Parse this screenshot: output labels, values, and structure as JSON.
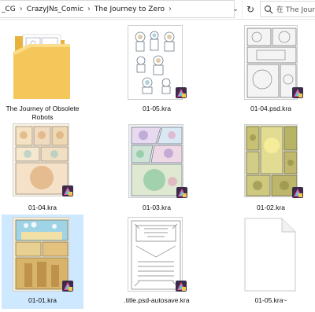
{
  "address_bar": {
    "crumbs": [
      "_CG",
      "CrazyJNs_Comic",
      "The Journey to Zero"
    ],
    "search_placeholder": "在 The Journey"
  },
  "files": [
    {
      "name": "The Journey of Obsolete Robots",
      "type": "folder"
    },
    {
      "name": "01-05.kra",
      "type": "kra"
    },
    {
      "name": "01-04.psd.kra",
      "type": "kra"
    },
    {
      "name": "01-04.kra",
      "type": "kra"
    },
    {
      "name": "01-03.kra",
      "type": "kra"
    },
    {
      "name": "01-02.kra",
      "type": "kra"
    },
    {
      "name": "01-01.kra",
      "type": "kra",
      "selected": true
    },
    {
      "name": ".title.psd-autosave.kra",
      "type": "kra"
    },
    {
      "name": "01-05.kra~",
      "type": "blank"
    }
  ],
  "colors": {
    "selection": "#cde8ff",
    "folder": "#f5c75a"
  }
}
